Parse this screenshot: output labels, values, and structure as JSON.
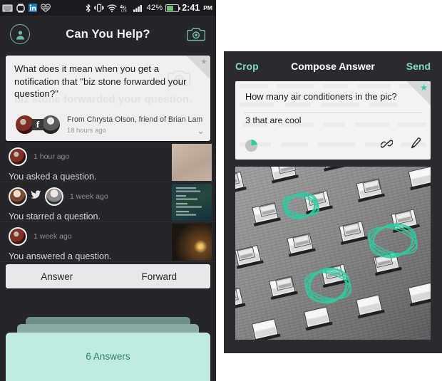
{
  "left_phone": {
    "status_bar": {
      "icons": [
        "keyboard-icon",
        "smartwatch-icon",
        "linkedin-icon",
        "fitness-heart-icon",
        "bluetooth-icon",
        "vibrate-icon",
        "wifi-icon",
        "lte-icon",
        "signal-bars-icon"
      ],
      "lte_label": "4G",
      "lte_sub": "LTE",
      "battery_percent": "42%",
      "time": "2:41",
      "meridiem": "PM"
    },
    "app_bar": {
      "profile_icon": "person-circle-icon",
      "title": "Can You Help?",
      "camera_icon": "camera-icon"
    },
    "question_card": {
      "star_icon": "star-icon",
      "camera_watermark_icon": "camera-icon",
      "text": "What does it mean when you get a notification that \"biz stone forwarded your question?\"",
      "watermark_text": "biz stone forwarded your question.",
      "from": "From Chrysta Olson, friend of Brian Lam",
      "timestamp": "18 hours ago",
      "expand_icon": "chevron-down-icon"
    },
    "feed": [
      {
        "timestamp": "1 hour ago",
        "text": "You asked a question.",
        "avatars": [
          "avatar-red-figure"
        ],
        "thumbnail": "beige-texture-thumbnail"
      },
      {
        "timestamp": "1 week ago",
        "text": "You starred a question.",
        "avatars": [
          "avatar-man-portrait",
          "twitter-bird-icon",
          "avatar-glasses-portrait"
        ],
        "thumbnail": "dark-chat-screenshot-thumbnail"
      },
      {
        "timestamp": "1 week ago",
        "text": "You answered a question.",
        "avatars": [
          "avatar-red-figure"
        ],
        "thumbnail": "night-lights-thumbnail"
      }
    ],
    "action_bar": {
      "answer_label": "Answer",
      "forward_label": "Forward"
    },
    "answer_stack": {
      "label": "6 Answers"
    }
  },
  "right_phone": {
    "nav_bar": {
      "crop_label": "Crop",
      "title": "Compose Answer",
      "send_label": "Send"
    },
    "answer_card": {
      "star_icon": "star-icon",
      "question": "How many air conditioners in the pic?",
      "answer": "3 that are cool",
      "progress_icon": "pie-progress-icon",
      "link_icon": "link-icon",
      "pen_icon": "pen-marker-icon"
    },
    "photo": {
      "description": "black-and-white building facade with air conditioner units",
      "annotation_count": 3,
      "annotation_icon": "circle-scribble-annotation"
    }
  },
  "colors": {
    "accent_teal": "#2ecca0",
    "link_teal": "#7fd9c2",
    "mint_card": "#bfeade",
    "dark_bg": "#26262a",
    "status_bar_bg": "#1b1b1e",
    "card_bg": "#efefef",
    "battery_green": "#6ec06e"
  }
}
